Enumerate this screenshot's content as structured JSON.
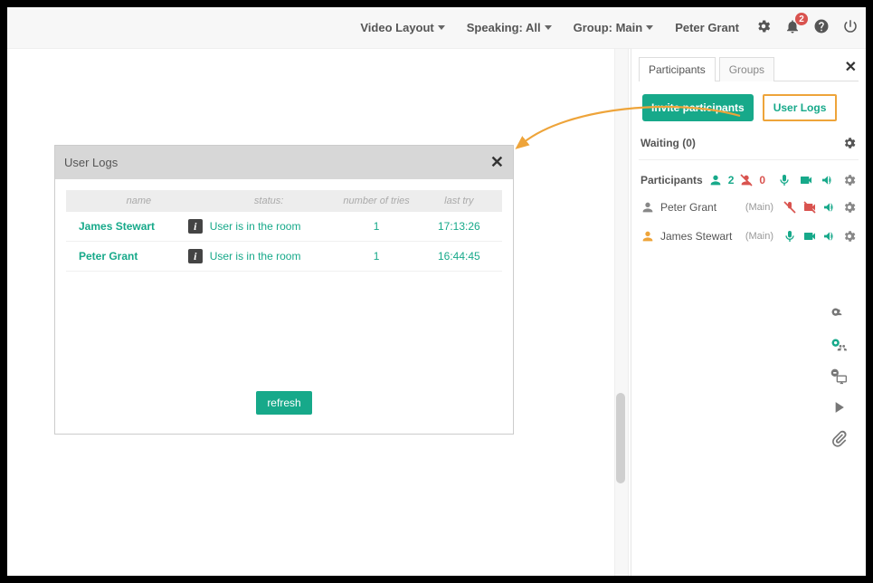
{
  "topbar": {
    "menu1": "Video Layout",
    "menu2": "Speaking: All",
    "menu3": "Group: Main",
    "user": "Peter Grant",
    "notifBadge": "2"
  },
  "panel": {
    "tabParticipants": "Participants",
    "tabGroups": "Groups",
    "inviteBtn": "Invite participants",
    "userLogsBtn": "User Logs",
    "waitingLabel": "Waiting (0)",
    "participantsLabel": "Participants",
    "countActive": "2",
    "countMuted": "0",
    "rows": [
      {
        "name": "Peter Grant",
        "room": "(Main)"
      },
      {
        "name": "James Stewart",
        "room": "(Main)"
      }
    ]
  },
  "modal": {
    "title": "User Logs",
    "headers": {
      "name": "name",
      "status": "status:",
      "tries": "number of tries",
      "last": "last try"
    },
    "rows": [
      {
        "name": "James Stewart",
        "status": "User is in the room",
        "tries": "1",
        "last": "17:13:26"
      },
      {
        "name": "Peter Grant",
        "status": "User is in the room",
        "tries": "1",
        "last": "16:44:45"
      }
    ],
    "refresh": "refresh"
  }
}
